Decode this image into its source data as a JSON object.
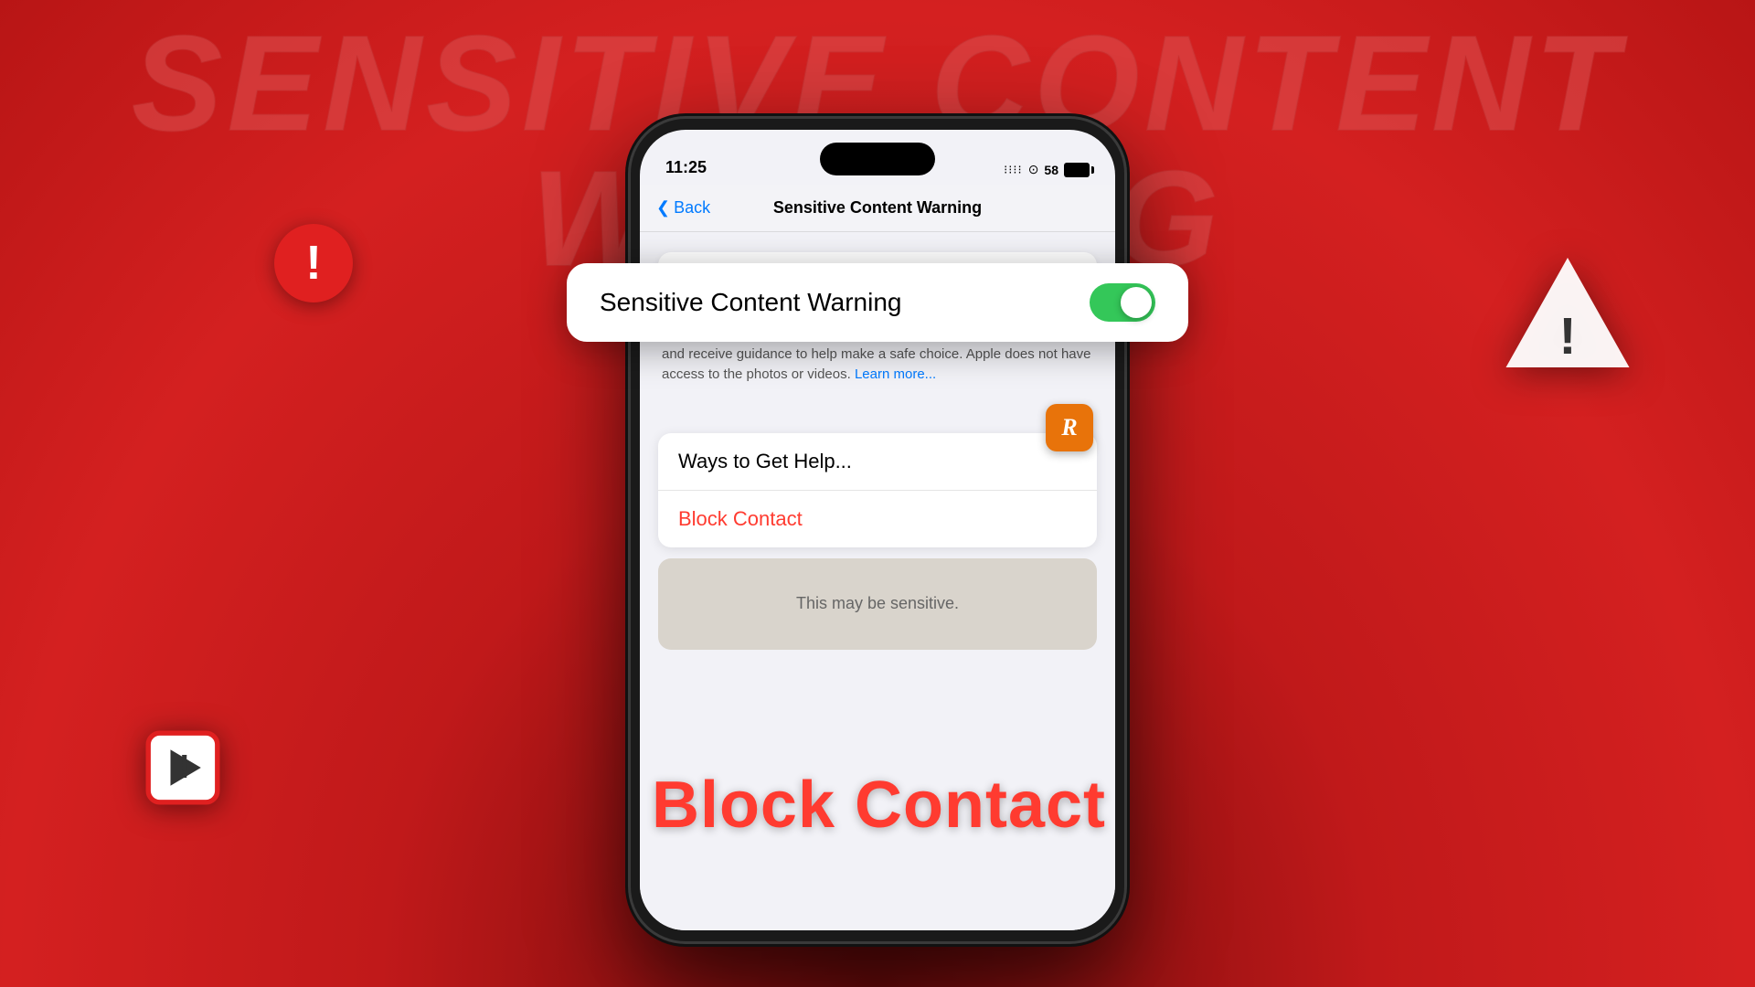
{
  "background": {
    "color": "#c0191a"
  },
  "main_title": "SENSITIVE CONTENT WARNING",
  "phone": {
    "status_bar": {
      "time": "11:25",
      "battery_percent": "58",
      "signal_bars": "||||"
    },
    "nav": {
      "back_label": "Back",
      "title": "Sensitive Content Warning"
    },
    "toggle_row": {
      "label": "Sensitive Content Warning",
      "enabled": true
    },
    "description": "Detect nude photos and videos before they are viewed on your iPhone, and receive guidance to help make a safe choice. Apple does not have access to the photos or videos.",
    "learn_more": "Learn more...",
    "menu": {
      "items": [
        {
          "label": "Ways to Get Help...",
          "color": "black"
        },
        {
          "label": "Block Contact",
          "color": "red"
        }
      ]
    },
    "sensitive_area_text": "This may be sensitive."
  },
  "decorative": {
    "exclamation": "!",
    "block_contact_label": "Block Contact"
  },
  "icons": {
    "chevron": "❮",
    "app_letter": "R",
    "exclamation": "!",
    "play": "▶"
  }
}
